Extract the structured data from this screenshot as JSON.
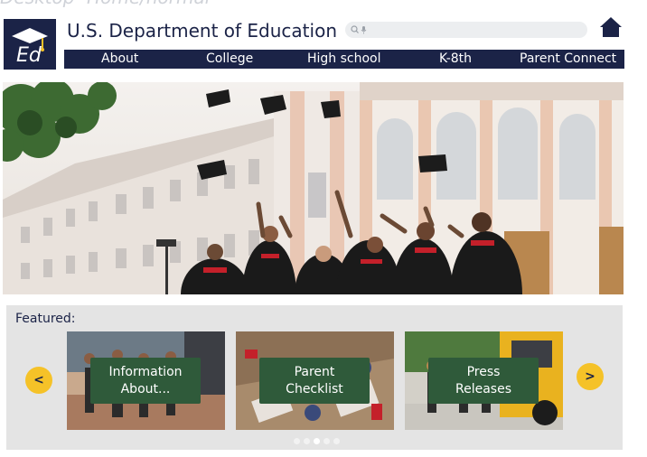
{
  "page": {
    "frame_title": "Desktop- Home/normal"
  },
  "header": {
    "logo_letters": "Ed",
    "site_title": "U.S. Department of  Education",
    "search": {
      "placeholder": "",
      "icons": [
        "search-icon",
        "microphone-icon"
      ]
    },
    "home_icon": "home-icon"
  },
  "nav": {
    "items": [
      {
        "label": "About"
      },
      {
        "label": "College"
      },
      {
        "label": "High school"
      },
      {
        "label": "K-8th"
      },
      {
        "label": "Parent Connect"
      }
    ]
  },
  "hero": {
    "image": "graduates-tossing-caps-photo"
  },
  "featured": {
    "label": "Featured:",
    "prev_label": "<",
    "next_label": ">",
    "cards": [
      {
        "title_line1": "Information",
        "title_line2": "About...",
        "image": "students-walking-photo"
      },
      {
        "title_line1": "Parent",
        "title_line2": "Checklist",
        "image": "classroom-photo"
      },
      {
        "title_line1": "Press",
        "title_line2": "Releases",
        "image": "school-bus-photo"
      }
    ],
    "pagination": {
      "count": 5,
      "active_index": 2
    }
  },
  "colors": {
    "navy": "#1b2347",
    "accent_yellow": "#f5c228",
    "card_button_green": "#2f5a3a",
    "featured_bg": "#e4e4e4"
  }
}
